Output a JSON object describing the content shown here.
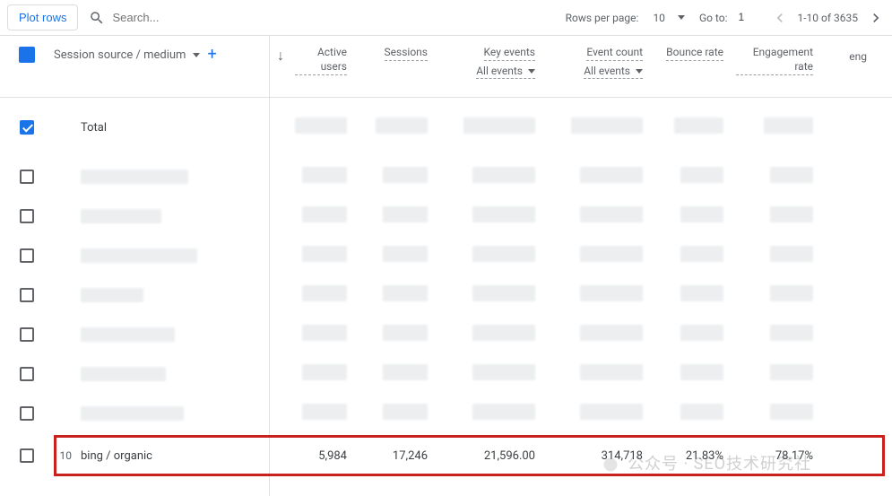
{
  "toolbar": {
    "plot_rows_label": "Plot rows",
    "search_placeholder": "Search...",
    "rows_per_page_label": "Rows per page:",
    "rows_per_page_value": "10",
    "goto_label": "Go to:",
    "goto_value": "1",
    "range_label": "1-10 of 3635"
  },
  "header": {
    "dimension_label": "Session source / medium",
    "metrics": {
      "active_users": "Active users",
      "sessions": "Sessions",
      "key_events": "Key events",
      "event_count": "Event count",
      "bounce_rate": "Bounce rate",
      "engagement_rate": "Engagement rate",
      "extra_partial": "eng"
    },
    "sub_all_events": "All events"
  },
  "rows": {
    "total_label": "Total",
    "highlighted": {
      "index": "10",
      "dimension": "bing / organic",
      "active_users": "5,984",
      "sessions": "17,246",
      "key_events": "21,596.00",
      "event_count": "314,718",
      "bounce_rate": "21.83%",
      "engagement_rate": "78.17%"
    }
  },
  "watermark": "公众号 · SEO技术研究社"
}
